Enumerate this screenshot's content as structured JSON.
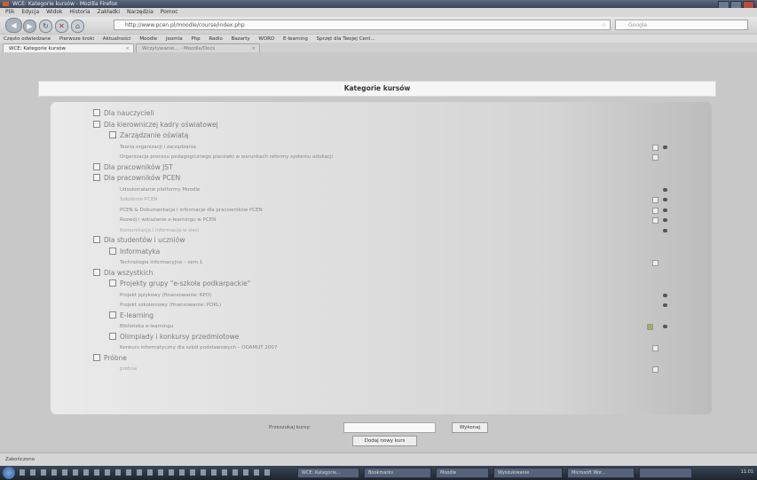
{
  "window": {
    "title": "WCE: Kategorie kursów - Mozilla Firefox"
  },
  "menu": [
    "Plik",
    "Edycja",
    "Widok",
    "Historia",
    "Zakładki",
    "Narzędzia",
    "Pomoc"
  ],
  "nav": {
    "url": "http://www.pcen.pl/moodle/course/index.php",
    "search_placeholder": "Google"
  },
  "bookmarks": [
    "Często odwiedzane",
    "Pierwsze kroki",
    "Aktualności",
    "Moodle",
    "Joomla",
    "Php",
    "Radio",
    "Bazarty",
    "WORD",
    "E-learning",
    "Sprzęt dla Twojej Cent..."
  ],
  "tabs": [
    {
      "label": "WCE: Kategorie kursów"
    },
    {
      "label": "Wczytywanie... - Moodle/Docs"
    }
  ],
  "page": {
    "title": "Kategorie kursów",
    "categories": [
      {
        "label": "Dla nauczycieli",
        "level": 0,
        "type": "category"
      },
      {
        "label": "Dla kierowniczej kadry oświatowej",
        "level": 0,
        "type": "category"
      },
      {
        "label": "Zarządzanie oświatą",
        "level": 1,
        "type": "category"
      },
      {
        "label": "Teoria organizacji i zarządzania",
        "level": 2,
        "type": "course",
        "icons": [
          "pen",
          "eye"
        ]
      },
      {
        "label": "Organizacja procesu pedagogicznego placówki w warunkach reformy systemu edukacji",
        "level": 2,
        "type": "course",
        "icons": [
          "pen"
        ]
      },
      {
        "label": "Dla pracowników JST",
        "level": 0,
        "type": "category"
      },
      {
        "label": "Dla pracowników PCEN",
        "level": 0,
        "type": "category"
      },
      {
        "label": "Udoskonalanie platformy Moodle",
        "level": 2,
        "type": "course",
        "icons": [
          "eye"
        ]
      },
      {
        "label": "Szkolenie PCEN",
        "level": 2,
        "type": "course",
        "dim": true,
        "icons": [
          "pen",
          "eye"
        ]
      },
      {
        "label": "PCEN & Dokumentacja i informacje dla pracowników PCEN",
        "level": 2,
        "type": "course",
        "icons": [
          "pen",
          "eye"
        ]
      },
      {
        "label": "Rozwój i wdrażanie e-learningu w PCEN",
        "level": 2,
        "type": "course",
        "icons": [
          "pen",
          "eye"
        ]
      },
      {
        "label": "Komunikacja i informacja w sieci",
        "level": 2,
        "type": "course",
        "dim": true,
        "icons": [
          "eye"
        ]
      },
      {
        "label": "Dla studentów i uczniów",
        "level": 0,
        "type": "category"
      },
      {
        "label": "Informatyka",
        "level": 1,
        "type": "category"
      },
      {
        "label": "Technologia informacyjna – sem.1",
        "level": 2,
        "type": "course",
        "icons": [
          "pen"
        ]
      },
      {
        "label": "Dla wszystkich",
        "level": 0,
        "type": "category"
      },
      {
        "label": "Projekty grupy \"e-szkoła podkarpackie\"",
        "level": 1,
        "type": "category"
      },
      {
        "label": "Projekt językowy (finansowanie: RPO)",
        "level": 2,
        "type": "course",
        "icons": [
          "eye"
        ]
      },
      {
        "label": "Projekt szkoleniowy (finansowanie: POKL)",
        "level": 2,
        "type": "course",
        "icons": [
          "eye"
        ]
      },
      {
        "label": "E-learning",
        "level": 1,
        "type": "category"
      },
      {
        "label": "Biblioteka e-learningu",
        "level": 2,
        "type": "course",
        "icons": [
          "edit",
          "eye"
        ]
      },
      {
        "label": "Olimpiady i konkursy przedmiotowe",
        "level": 1,
        "type": "category"
      },
      {
        "label": "Konkurs informatyczny dla szkół podstawowych – ODAMUT 2007",
        "level": 2,
        "type": "course",
        "icons": [
          "pen"
        ]
      },
      {
        "label": "Próbne",
        "level": 0,
        "type": "category"
      },
      {
        "label": "probne",
        "level": 2,
        "type": "course",
        "dim": true,
        "icons": [
          "pen"
        ]
      }
    ],
    "search_label": "Przeszukaj kursy:",
    "search_button": "Wykonaj",
    "add_course_button": "Dodaj nowy kurs"
  },
  "status": {
    "text": "Zakończono"
  },
  "taskbar": {
    "tasks": [
      "WCE: Kategorie...",
      "Bookmarks",
      "Moodle",
      "Wyszukiwanie",
      "Microsoft Wor...",
      ""
    ],
    "tray": "11:01"
  },
  "colors": {
    "panel": "#d5d5d5",
    "header_bg": "#f6f6f6",
    "taskbar": "#2b3340"
  }
}
